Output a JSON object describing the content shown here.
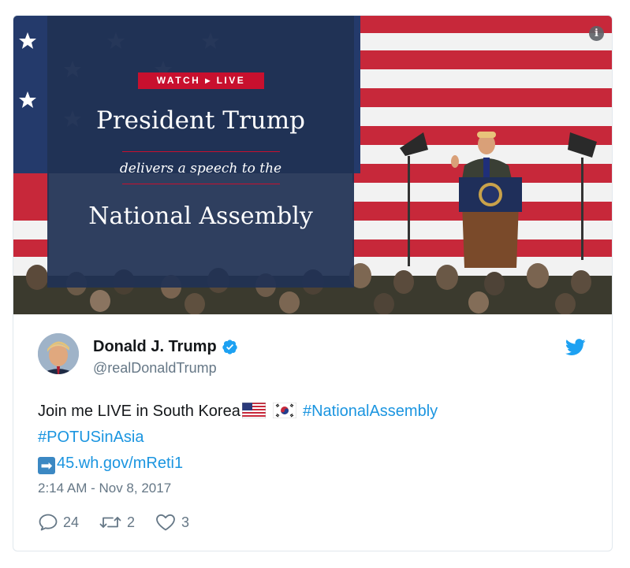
{
  "media": {
    "badge_watch": "WATCH",
    "badge_arrow": "▸",
    "badge_live": "LIVE",
    "title_line1": "President Trump",
    "title_line2": "delivers a speech to the",
    "title_line3": "National Assembly",
    "info_icon": "i"
  },
  "author": {
    "display_name": "Donald J. Trump",
    "handle": "@realDonaldTrump",
    "verified": true
  },
  "tweet": {
    "text_part1": "Join me LIVE in South Korea",
    "hashtag1": "#NationalAssembly",
    "hashtag2": "#POTUSinAsia",
    "arrow_emoji": "➡",
    "link": "45.wh.gov/mReti1",
    "timestamp": "2:14 AM - Nov 8, 2017"
  },
  "actions": {
    "replies": "24",
    "retweets": "2",
    "likes": "3"
  },
  "colors": {
    "link_blue": "#1b95e0",
    "twitter_blue": "#1da1f2",
    "muted_gray": "#657786",
    "badge_red": "#c8102e",
    "panel_navy": "#203154"
  },
  "icons": [
    "info-icon",
    "verified-badge-icon",
    "twitter-bird-icon",
    "us-flag-emoji",
    "south-korea-flag-emoji",
    "right-arrow-emoji",
    "reply-icon",
    "retweet-icon",
    "like-icon"
  ]
}
